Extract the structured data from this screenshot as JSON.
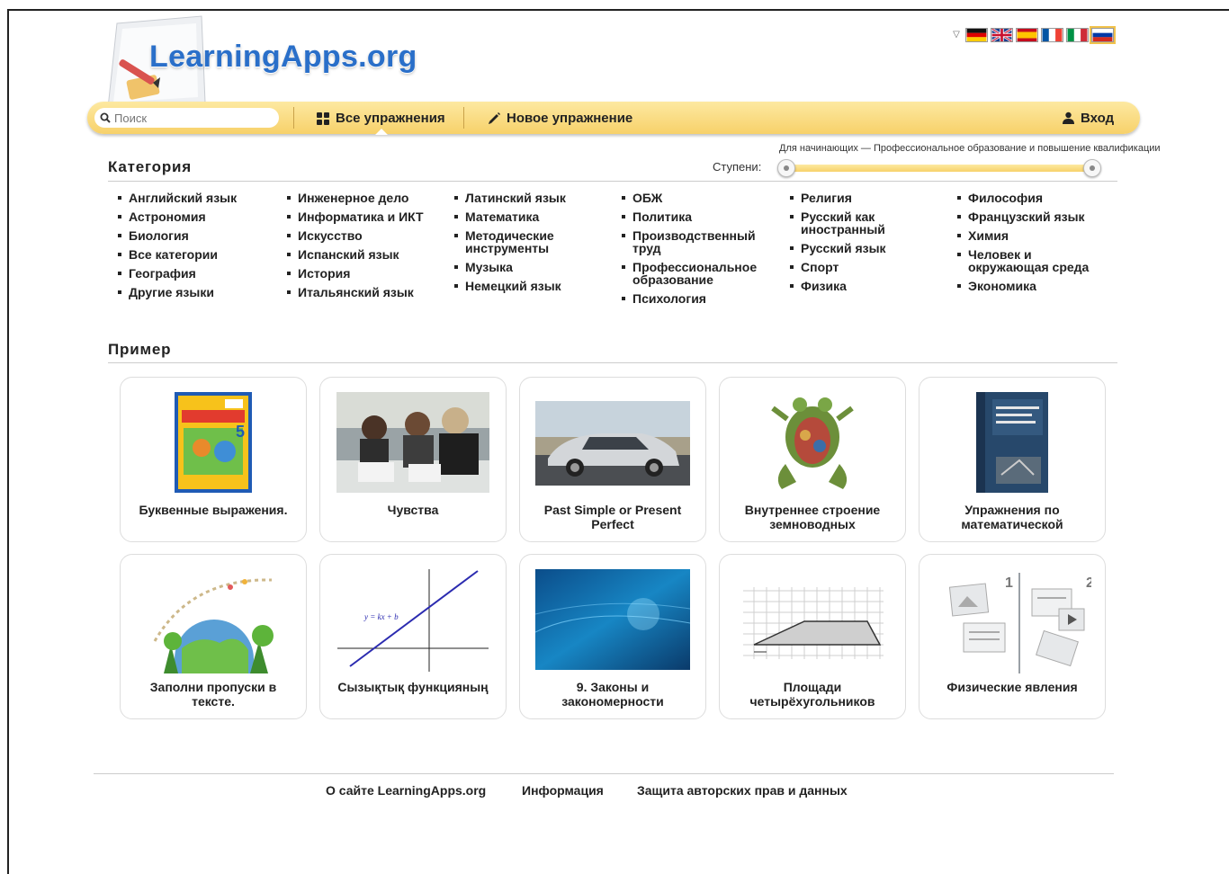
{
  "header": {
    "logo_text": "LearningApps.org"
  },
  "languages": {
    "flags": [
      "de",
      "en",
      "es",
      "fr",
      "it",
      "ru"
    ],
    "active": "ru"
  },
  "toolbar": {
    "search_placeholder": "Поиск",
    "all_exercises": "Все упражнения",
    "new_exercise": "Новое упражнение",
    "login": "Вход"
  },
  "category": {
    "title": "Категория",
    "levels_label": "Ступени:",
    "levels_caption": "Для начинающих — Профессиональное образование и повышение квалификации",
    "level_range": [
      0,
      1
    ],
    "columns": [
      [
        "Английский язык",
        "Астрономия",
        "Биология",
        "Все категории",
        "География",
        "Другие языки"
      ],
      [
        "Инженерное дело",
        "Информатика и ИКТ",
        "Искусство",
        "Испанский язык",
        "История",
        "Итальянский язык"
      ],
      [
        "Латинский язык",
        "Математика",
        "Методические инструменты",
        "Музыка",
        "Немецкий язык"
      ],
      [
        "ОБЖ",
        "Политика",
        "Производственный труд",
        "Профессиональное образование",
        "Психология"
      ],
      [
        "Религия",
        "Русский как иностранный",
        "Русский язык",
        "Спорт",
        "Физика"
      ],
      [
        "Философия",
        "Французский язык",
        "Химия",
        "Человек и окружающая среда",
        "Экономика"
      ]
    ]
  },
  "examples": {
    "title": "Пример",
    "cards": [
      {
        "caption": "Буквенные выражения.",
        "image": "math-book-cover"
      },
      {
        "caption": "Чувства",
        "image": "people-photo"
      },
      {
        "caption": "Past Simple or Present Perfect",
        "image": "car-photo"
      },
      {
        "caption": "Внутреннее строение земноводных",
        "image": "frog-anatomy"
      },
      {
        "caption": "Упражнения по математической",
        "image": "math-logic-book"
      },
      {
        "caption": "Заполни пропуски в тексте.",
        "image": "globe-illustration"
      },
      {
        "caption": "Сызықтық функцияның",
        "image": "linear-function-graph"
      },
      {
        "caption": "9. Законы и закономерности",
        "image": "digital-blue"
      },
      {
        "caption": "Площади четырёхугольников",
        "image": "trapezoid-grid"
      },
      {
        "caption": "Физические явления",
        "image": "matching-icons"
      }
    ]
  },
  "graph_label": "y = kx + b",
  "footer": {
    "about": "О сайте LearningApps.org",
    "info": "Информация",
    "privacy": "Защита авторских прав и данных"
  }
}
